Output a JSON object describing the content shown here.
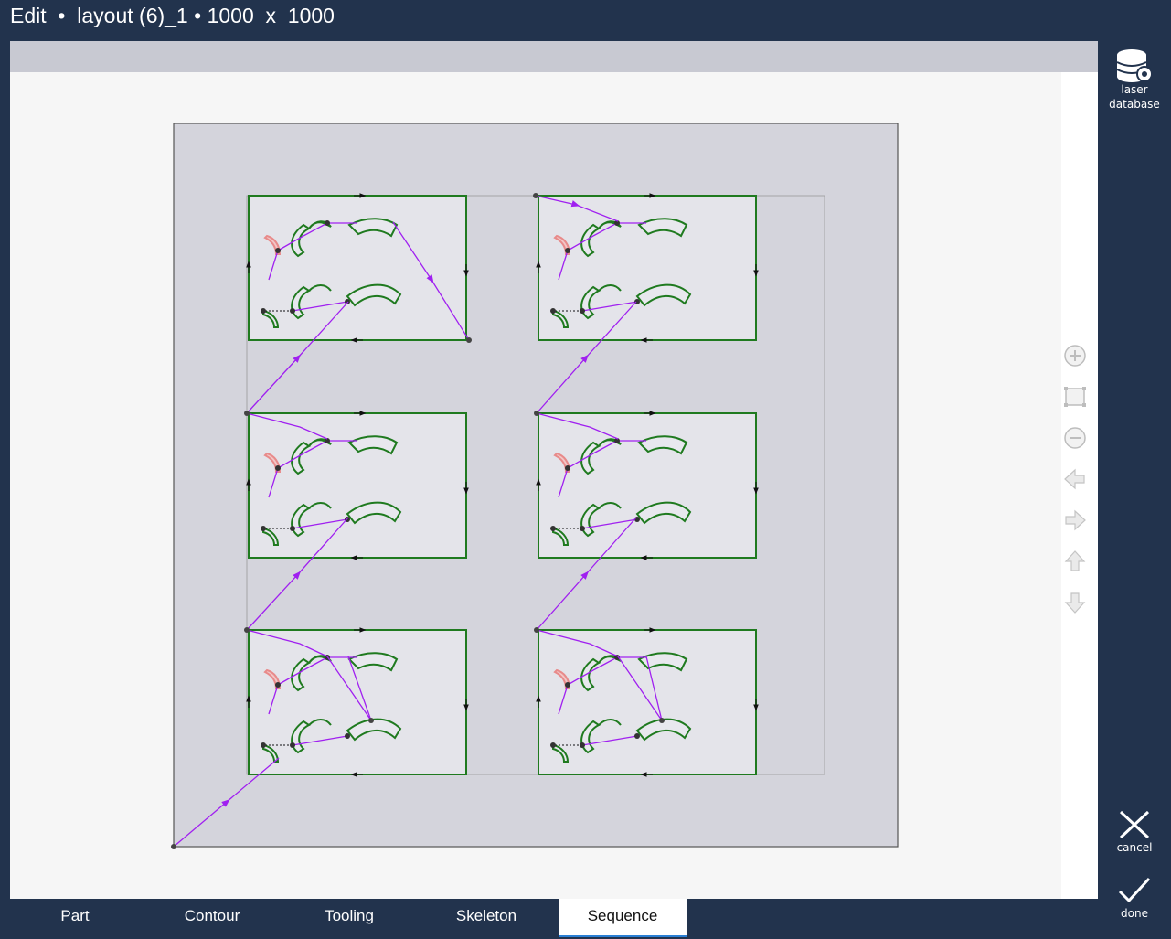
{
  "window": {
    "title_mode": "Edit",
    "title_sep": "•",
    "layout_name": "layout (6)_1",
    "sheet_size": "1000  x  1000"
  },
  "sidebar": {
    "laser_database_label_1": "laser",
    "laser_database_label_2": "database",
    "cancel_label": "cancel",
    "done_label": "done"
  },
  "tabs": [
    {
      "label": "Part"
    },
    {
      "label": "Contour"
    },
    {
      "label": "Tooling"
    },
    {
      "label": "Skeleton"
    },
    {
      "label": "Sequence",
      "active": true
    }
  ],
  "navigation_icons": [
    "zoom-in-icon",
    "zoom-extents-icon",
    "zoom-out-icon",
    "pan-left-icon",
    "pan-right-icon",
    "pan-up-icon",
    "pan-down-icon"
  ],
  "colors": {
    "frame": "#22334d",
    "part_outline": "#1f7a1f",
    "sequence_path": "#a020f0",
    "sheet": "#d4d4dc",
    "warning_contour": "#e88a8a"
  },
  "layout": {
    "part_count": 6,
    "grid": "2 columns x 3 rows"
  }
}
